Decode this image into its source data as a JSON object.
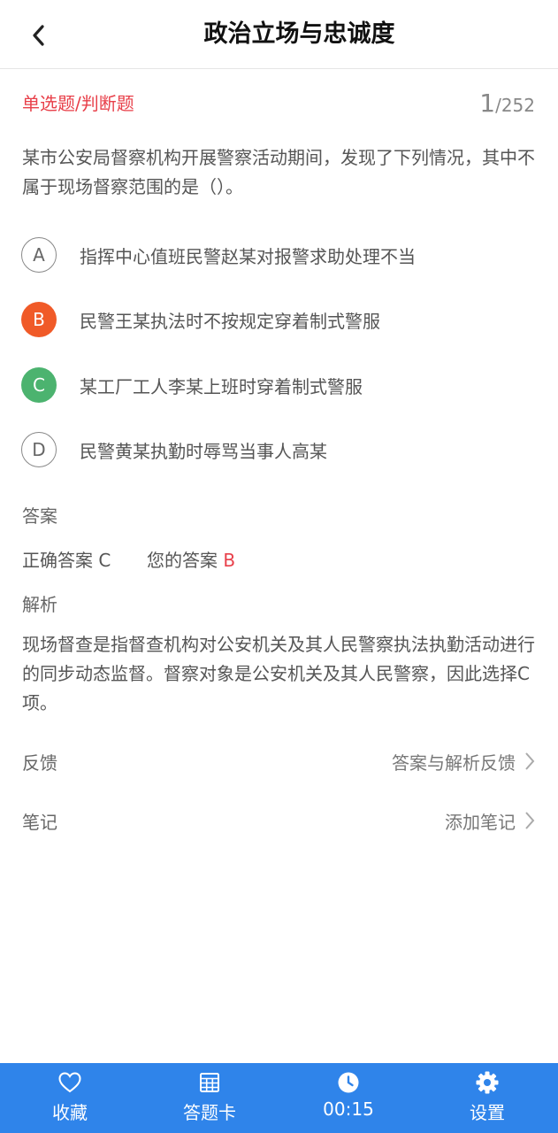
{
  "header": {
    "title": "政治立场与忠诚度"
  },
  "question": {
    "type": "单选题/判断题",
    "current": "1",
    "total": "/252",
    "text": "某市公安局督察机构开展警察活动期间，发现了下列情况，其中不属于现场督察范围的是（）。",
    "options": [
      {
        "letter": "A",
        "text": "指挥中心值班民警赵某对报警求助处理不当",
        "state": "normal"
      },
      {
        "letter": "B",
        "text": "民警王某执法时不按规定穿着制式警服",
        "state": "wrong",
        "color": "#f05a28"
      },
      {
        "letter": "C",
        "text": "某工厂工人李某上班时穿着制式警服",
        "state": "correct",
        "color": "#4cb36f"
      },
      {
        "letter": "D",
        "text": "民警黄某执勤时辱骂当事人高某",
        "state": "normal"
      }
    ]
  },
  "answer": {
    "section_label": "答案",
    "correct_label": "正确答案",
    "correct_value": "C",
    "yours_label": "您的答案",
    "yours_value": "B"
  },
  "analysis": {
    "section_label": "解析",
    "text": "现场督查是指督查机构对公安机关及其人民警察执法执勤活动进行的同步动态监督。督察对象是公安机关及其人民警察，因此选择C项。"
  },
  "feedback": {
    "label": "反馈",
    "link": "答案与解析反馈"
  },
  "notes": {
    "label": "笔记",
    "link": "添加笔记"
  },
  "bottom_bar": {
    "background": "#2f84ea",
    "tabs": [
      {
        "label": "收藏",
        "icon": "heart-icon"
      },
      {
        "label": "答题卡",
        "icon": "grid-icon"
      },
      {
        "label": "00:15",
        "icon": "clock-icon"
      },
      {
        "label": "设置",
        "icon": "gear-icon"
      }
    ]
  },
  "colors": {
    "accent_red": "#e8404a"
  }
}
